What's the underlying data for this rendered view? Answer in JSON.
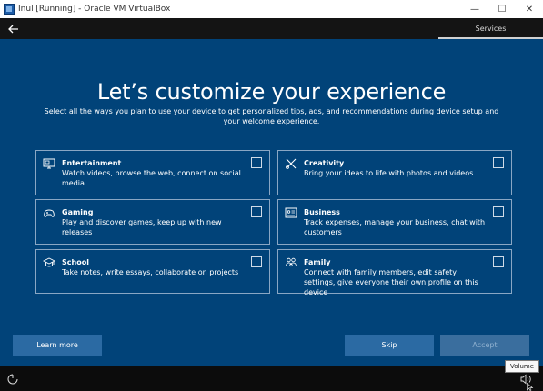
{
  "window": {
    "title": "Inul [Running] - Oracle VM VirtualBox",
    "minimize_glyph": "—",
    "maximize_glyph": "☐",
    "close_glyph": "✕"
  },
  "nav": {
    "services_tab": "Services"
  },
  "page": {
    "title": "Let’s customize your experience",
    "subtitle": "Select all the ways you plan to use your device to get personalized tips, ads, and recommendations during device setup and your welcome experience."
  },
  "options": [
    {
      "icon": "monitor-icon",
      "title": "Entertainment",
      "description": "Watch videos, browse the web, connect on social media",
      "checked": false
    },
    {
      "icon": "creativity-tools-icon",
      "title": "Creativity",
      "description": "Bring your ideas to life with photos and videos",
      "checked": false
    },
    {
      "icon": "gaming-icon",
      "title": "Gaming",
      "description": "Play and discover games, keep up with new releases",
      "checked": false
    },
    {
      "icon": "business-card-icon",
      "title": "Business",
      "description": "Track expenses, manage your business, chat with customers",
      "checked": false
    },
    {
      "icon": "graduation-cap-icon",
      "title": "School",
      "description": "Take notes, write essays, collaborate on projects",
      "checked": false
    },
    {
      "icon": "family-icon",
      "title": "Family",
      "description": "Connect with family members, edit safety settings, give everyone their own profile on this device",
      "checked": false
    }
  ],
  "buttons": {
    "learn_more": "Learn more",
    "skip": "Skip",
    "accept": "Accept"
  },
  "tooltip": "Volume",
  "colors": {
    "background": "#014379",
    "button": "#2b6aa3",
    "button_disabled": "#3a6e9e",
    "card_border": "#8aa7c4"
  }
}
